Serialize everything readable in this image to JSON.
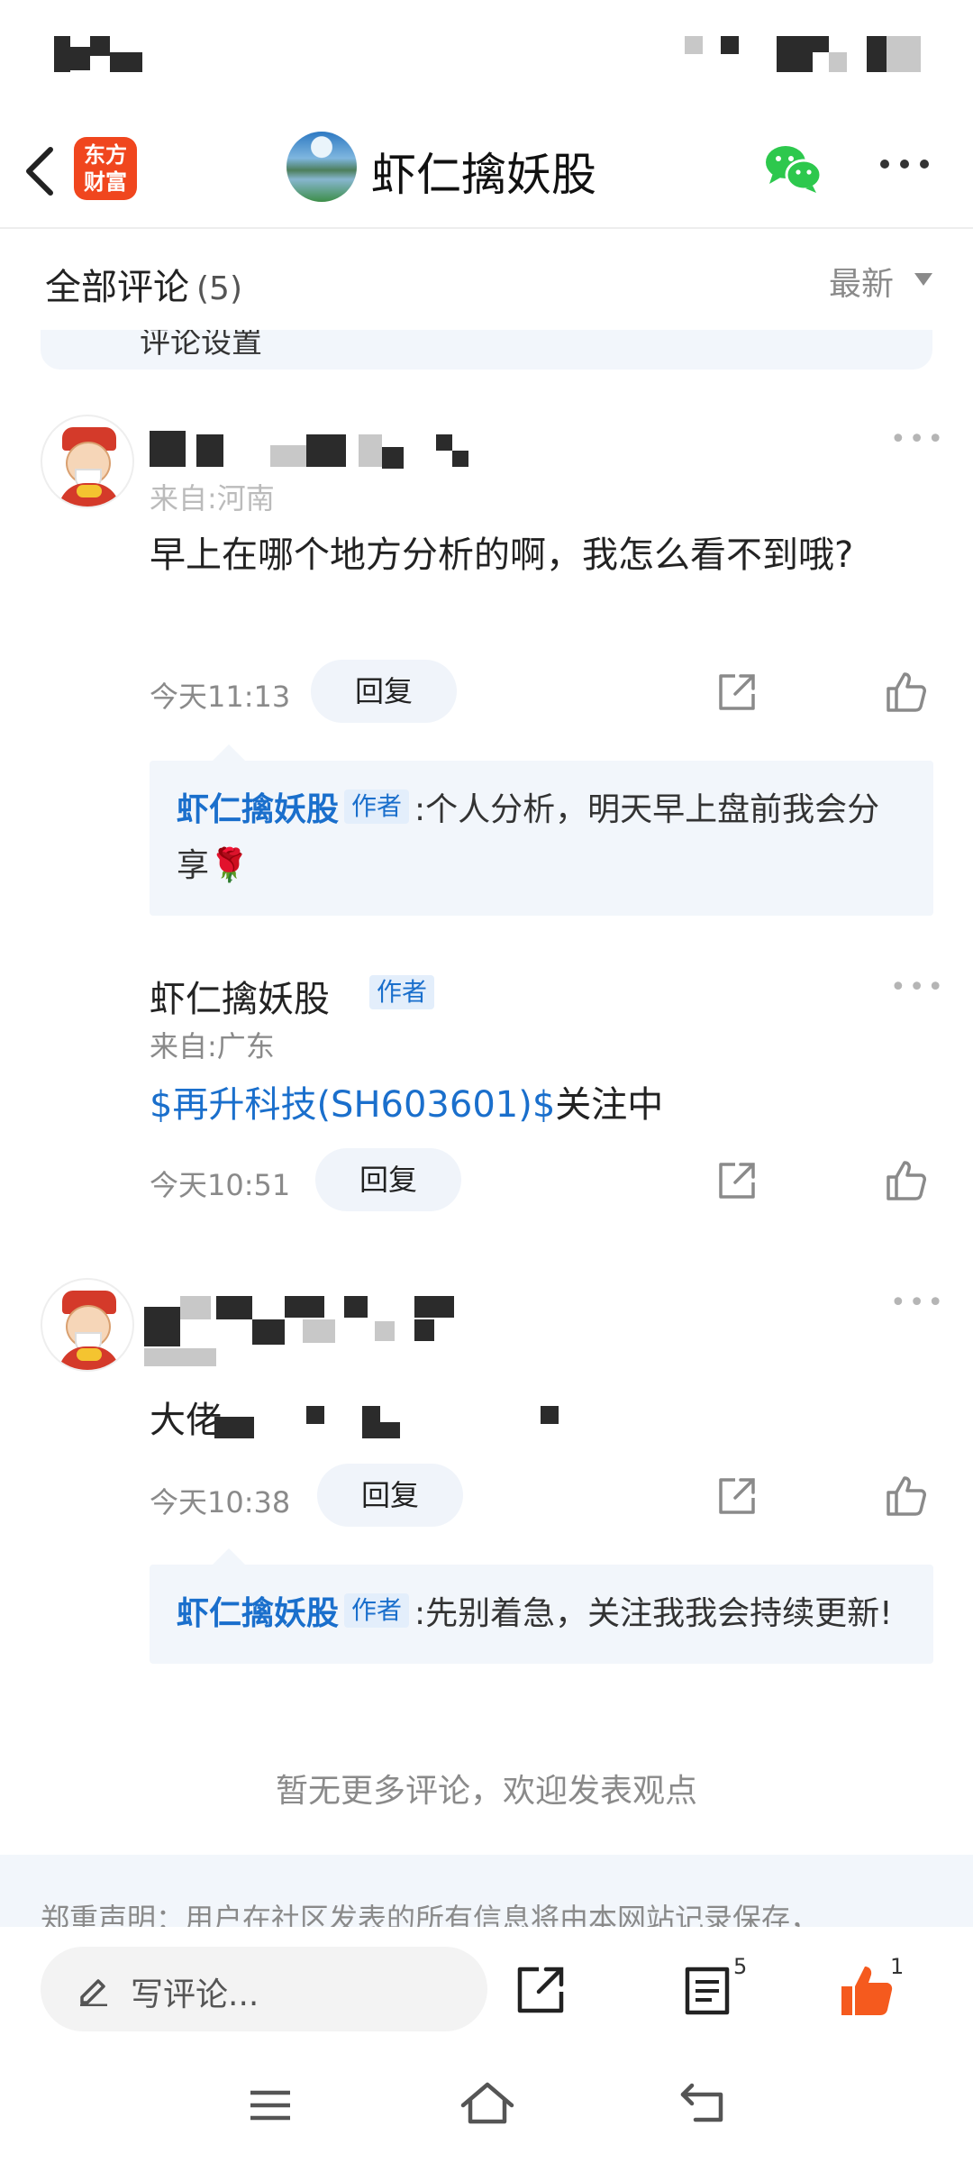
{
  "nav": {
    "app_logo_text": "东方\n财富",
    "title": "虾仁擒妖股"
  },
  "comments_header": {
    "title": "全部评论",
    "count": "(5)",
    "sort_label": "最新"
  },
  "settings_strip": {
    "label": "评论设置"
  },
  "comments": [
    {
      "location": "来自:河南",
      "content": "早上在哪个地方分析的啊，我怎么看不到哦?",
      "time": "今天11:13",
      "reply_label": "回复",
      "reply": {
        "author": "虾仁擒妖股",
        "tag": "作者",
        "text": ":个人分析，明天早上盘前我会分享🌹"
      }
    },
    {
      "author": "虾仁擒妖股",
      "tag": "作者",
      "location": "来自:广东",
      "stock_link": "$再升科技(SH603601)$",
      "content_suffix": "关注中",
      "time": "今天10:51",
      "reply_label": "回复"
    },
    {
      "content_prefix": "大佬",
      "time": "今天10:38",
      "reply_label": "回复",
      "reply": {
        "author": "虾仁擒妖股",
        "tag": "作者",
        "text": ":先别着急，关注我我会持续更新!"
      }
    }
  ],
  "footer": {
    "no_more": "暂无更多评论，欢迎发表观点",
    "disclaimer": "郑重声明：用户在社区发表的所有信息将由本网站记录保存，"
  },
  "bottom_bar": {
    "write_placeholder": "写评论...",
    "comment_count_badge": "5",
    "like_count_badge": "1"
  },
  "colors": {
    "link_blue": "#1a6fcc",
    "like_orange": "#f55a1e",
    "wechat_green": "#2dc84d",
    "brand_red": "#f0461e"
  }
}
